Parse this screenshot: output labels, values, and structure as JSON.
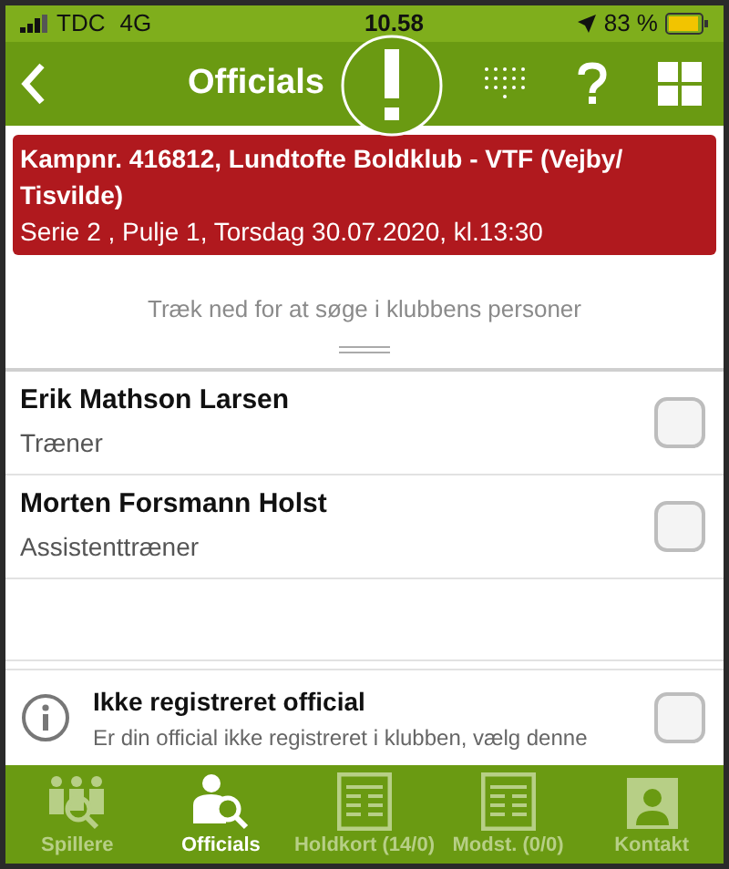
{
  "status_bar": {
    "carrier": "TDC",
    "network": "4G",
    "time": "10.58",
    "battery": "83 %"
  },
  "header": {
    "title": "Officials"
  },
  "match_banner": {
    "line_1": "Kampnr. 416812, Lundtofte Boldklub - VTF (Vejby/ Tisvilde)",
    "line_2": "Serie 2 , Pulje 1, Torsdag 30.07.2020, kl.13:30"
  },
  "hint": "Træk ned for at søge i klubbens personer",
  "officials": [
    {
      "name": "Erik Mathson Larsen",
      "role": "Træner",
      "checked": false
    },
    {
      "name": "Morten Forsmann Holst",
      "role": "Assistenttræner",
      "checked": false
    }
  ],
  "unregistered": {
    "title": "Ikke registreret official",
    "description": "Er din official ikke registreret i klubben, vælg denne",
    "checked": false
  },
  "tabs": [
    {
      "label": "Spillere",
      "kind": "players",
      "selected": false
    },
    {
      "label": "Officials",
      "kind": "official",
      "selected": true
    },
    {
      "label": "Holdkort (14/0)",
      "kind": "card",
      "selected": false
    },
    {
      "label": "Modst. (0/0)",
      "kind": "card",
      "selected": false
    },
    {
      "label": "Kontakt",
      "kind": "contact",
      "selected": false
    }
  ]
}
